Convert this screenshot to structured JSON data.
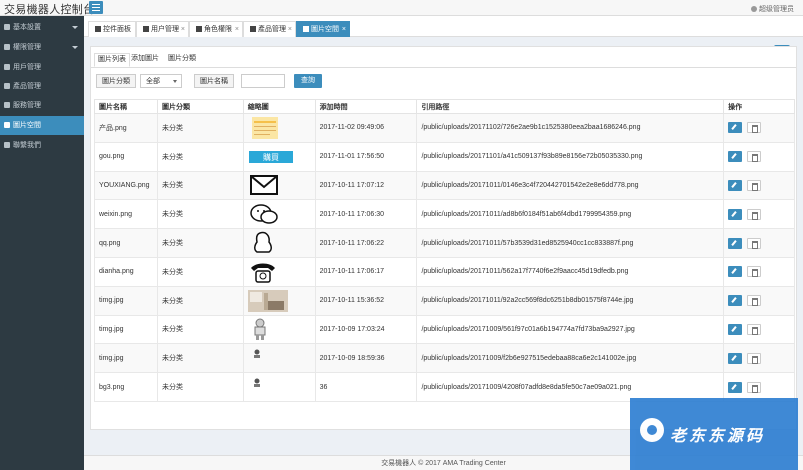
{
  "app": {
    "title": "交易機器人控制台",
    "user": "超级管理员"
  },
  "sidebar": {
    "items": [
      {
        "label": "基本設置",
        "icon": "gear-icon",
        "expandable": true,
        "active": false
      },
      {
        "label": "權限管理",
        "icon": "users-icon",
        "expandable": true,
        "active": false
      },
      {
        "label": "用戶管理",
        "icon": "user-icon",
        "expandable": false,
        "active": false
      },
      {
        "label": "產品管理",
        "icon": "box-icon",
        "expandable": false,
        "active": false
      },
      {
        "label": "服務管理",
        "icon": "list-icon",
        "expandable": false,
        "active": false
      },
      {
        "label": "圖片空間",
        "icon": "image-icon",
        "expandable": false,
        "active": true
      },
      {
        "label": "聯繫我們",
        "icon": "contact-icon",
        "expandable": false,
        "active": false
      }
    ]
  },
  "tabs": [
    {
      "label": "控件面板",
      "icon": "home-icon",
      "closable": false,
      "active": false
    },
    {
      "label": "用户管理",
      "icon": "user-icon",
      "closable": true,
      "active": false
    },
    {
      "label": "角色權限",
      "icon": "check-icon",
      "closable": true,
      "active": false
    },
    {
      "label": "產品管理",
      "icon": "edit-icon",
      "closable": true,
      "active": false
    },
    {
      "label": "圖片空間",
      "icon": "image-icon",
      "closable": true,
      "active": true
    }
  ],
  "subtabs": [
    "圖片列表",
    "添加圖片",
    "圖片分類"
  ],
  "filter": {
    "category_label": "圖片分類",
    "category_value": "全部",
    "name_label": "圖片名稱",
    "name_value": "",
    "query_label": "查詢"
  },
  "table": {
    "headers": [
      "圖片名稱",
      "圖片分類",
      "縮略圖",
      "添加時間",
      "引用路徑",
      "操作"
    ],
    "rows": [
      {
        "name": "产品.png",
        "category": "未分类",
        "thumb": "product-thumbnail",
        "time": "2017-11-02 09:49:06",
        "path": "/public/uploads/20171102/726e2ae9b1c1525380eea2baa1686246.png"
      },
      {
        "name": "gou.png",
        "category": "未分类",
        "thumb": "buy-button-thumbnail",
        "thumb_text": "購買",
        "time": "2017-11-01 17:56:50",
        "path": "/public/uploads/20171101/a41c509137f93b89e8156e72b05035330.png"
      },
      {
        "name": "YOUXIANG.png",
        "category": "未分类",
        "thumb": "envelope-icon",
        "time": "2017-10-11 17:07:12",
        "path": "/public/uploads/20171011/0146e3c4f720442701542e2e8e6dd778.png"
      },
      {
        "name": "weixin.png",
        "category": "未分类",
        "thumb": "wechat-icon",
        "time": "2017-10-11 17:06:30",
        "path": "/public/uploads/20171011/ad8b6f0184f51ab6f4dbd1799954359.png"
      },
      {
        "name": "qq.png",
        "category": "未分类",
        "thumb": "qq-penguin-icon",
        "time": "2017-10-11 17:06:22",
        "path": "/public/uploads/20171011/57b3539d31ed8525940cc1cc833887f.png"
      },
      {
        "name": "dianha.png",
        "category": "未分类",
        "thumb": "telephone-icon",
        "time": "2017-10-11 17:06:17",
        "path": "/public/uploads/20171011/562a17f7740f6e2f9aacc45d19dfedb.png"
      },
      {
        "name": "timg.jpg",
        "category": "未分类",
        "thumb": "room-photo-thumbnail",
        "time": "2017-10-11 15:36:52",
        "path": "/public/uploads/20171011/92a2cc569f8dc6251b8db01575f8744e.jpg"
      },
      {
        "name": "timg.jpg",
        "category": "未分类",
        "thumb": "robot-thumbnail",
        "time": "2017-10-09 17:03:24",
        "path": "/public/uploads/20171009/561f97c01a6b194774a7fd73ba9a2927.jpg"
      },
      {
        "name": "timg.jpg",
        "category": "未分类",
        "thumb": "small-figure-thumbnail",
        "time": "2017-10-09 18:59:36",
        "path": "/public/uploads/20171009/f2b6e927515edebaa88ca6e2c141002e.jpg"
      },
      {
        "name": "bg3.png",
        "category": "未分类",
        "thumb": "small-figure-thumbnail",
        "time": "36",
        "path": "/public/uploads/20171009/4208f07adfd8e8da5fe50c7ae09a021.png"
      }
    ]
  },
  "footer": {
    "text": "交易機器人 © 2017  AMA Trading Center"
  },
  "watermark": {
    "text": "老东东源码"
  },
  "colors": {
    "accent": "#3c8dbc",
    "sidebar": "#2d3a42"
  }
}
